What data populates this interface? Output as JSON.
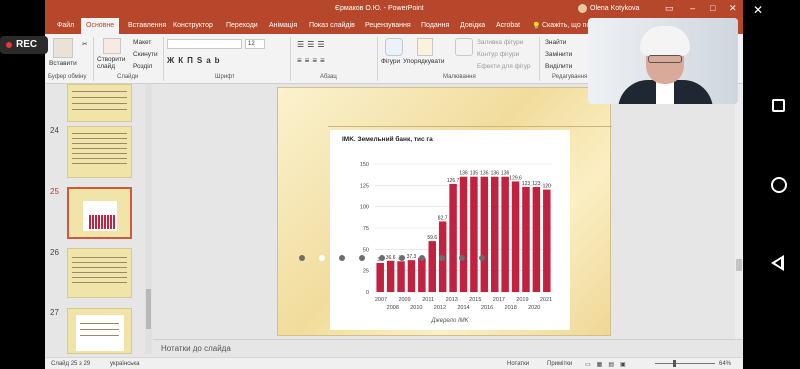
{
  "window": {
    "title": "Єрмаков О.Ю.  -  PowerPoint",
    "user": "Olena Kotykova"
  },
  "tabs": [
    "Файл",
    "Основне",
    "Вставлення",
    "Конструктор",
    "Переходи",
    "Анімація",
    "Показ слайдів",
    "Рецензування",
    "Подання",
    "Довідка",
    "Acrobat",
    "Скажіть, що пот"
  ],
  "active_tab_index": 1,
  "ribbon": {
    "paste": "Вставити",
    "new_slide": "Створити слайд",
    "layout": "Макет",
    "reset": "Скинути",
    "sections": "Розділ",
    "font_size": "12",
    "shapes": "Фігури",
    "arrange": "Упорядкувати",
    "shape_fill": "Заливка фігури",
    "shape_outline": "Контур фігури",
    "shape_effects": "Ефекти для фігур",
    "find": "Знайти",
    "replace": "Замінити",
    "select": "Виділити",
    "groups": [
      "Буфер обміну",
      "Слайди",
      "Шрифт",
      "Абзац",
      "Малювання",
      "Редагування"
    ]
  },
  "recording": {
    "label": "REC",
    "color": "#e53935"
  },
  "thumbnails": [
    {
      "number": "24"
    },
    {
      "number": "25",
      "selected": true
    },
    {
      "number": "26"
    },
    {
      "number": "27"
    }
  ],
  "notes_placeholder": "Нотатки до слайда",
  "status": {
    "slide": "Слайд 25 з 29",
    "language": "українська",
    "notes": "Нотатки",
    "comments": "Примітки",
    "zoom": "64%"
  },
  "colors": {
    "accent": "#b7472a",
    "bar": "#c0223f"
  },
  "chart_data": {
    "type": "bar",
    "title": "IMK. Земельний банк, тис га",
    "source": "Джерело IMK",
    "categories": [
      "2007",
      "2008",
      "2009",
      "2009",
      "2010",
      "2011",
      "2012",
      "2013",
      "2014",
      "2015",
      "2016",
      "2016",
      "2017",
      "2018",
      "2019",
      "2020",
      "2021"
    ],
    "values": [
      34,
      36.6,
      36,
      37.3,
      40,
      59.6,
      82.7,
      126.7,
      135.1,
      135.1,
      135.1,
      135.1,
      135.1,
      129.6,
      123.1,
      123,
      120
    ],
    "data_labels": [
      "34",
      "36.6",
      "36",
      "37.3",
      "",
      "59.6",
      "82.7",
      "126.7",
      "136",
      "135",
      "136",
      "136",
      "136",
      "129.6",
      "123",
      "123",
      "120"
    ],
    "x_tick_labels_upper": [
      "2007",
      "2009",
      "2011",
      "2013",
      "2015",
      "2017",
      "2019",
      "2021"
    ],
    "x_tick_labels_lower": [
      "2008",
      "2010",
      "2012",
      "2014",
      "2016",
      "2018",
      "2020"
    ],
    "y_ticks": [
      "0",
      "25",
      "50",
      "75",
      "100",
      "125",
      "150"
    ],
    "ylim": [
      0,
      150
    ],
    "grid": true
  }
}
